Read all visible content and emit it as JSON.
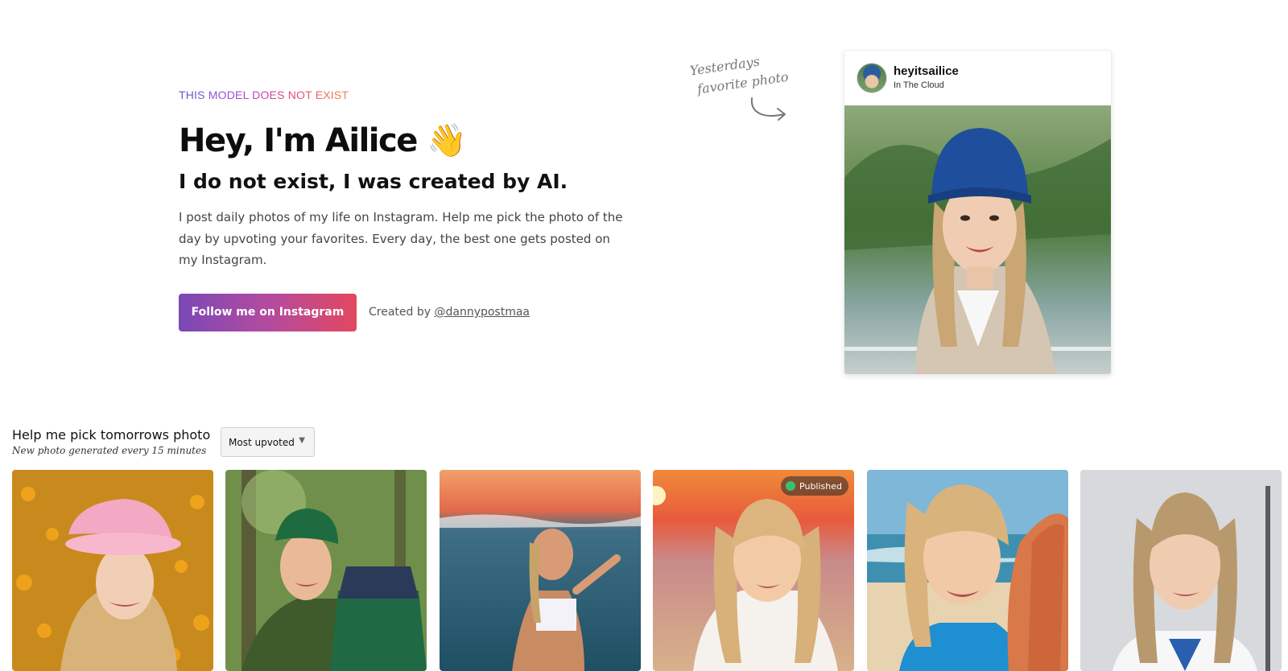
{
  "hero": {
    "eyebrow": "THIS MODEL DOES NOT EXIST",
    "title": "Hey, I'm Ailice 👋",
    "subtitle": "I do not exist, I was created by AI.",
    "description": "I post daily photos of my life on Instagram. Help me pick the photo of the day by upvoting your favorites. Every day, the best one gets posted on my Instagram.",
    "cta_label": "Follow me on Instagram",
    "credit_prefix": "Created by",
    "credit_handle": "@dannypostmaa"
  },
  "featured": {
    "note_line1": "Yesterdays",
    "note_line2": "favorite photo",
    "username": "heyitsailice",
    "location": "In The Cloud"
  },
  "picker": {
    "title": "Help me pick tomorrows photo",
    "subtitle": "New photo generated every 15 minutes",
    "sort_selected": "Most upvoted"
  },
  "photos": [
    {
      "scene": "flower-field-pink-hat",
      "published": false
    },
    {
      "scene": "forest-green-cap-backpack",
      "published": false
    },
    {
      "scene": "ocean-sunset-swimsuit",
      "published": false
    },
    {
      "scene": "beach-sunset-portrait",
      "published": true,
      "badge_label": "Published"
    },
    {
      "scene": "beach-surfboard",
      "published": false
    },
    {
      "scene": "clinic-portrait",
      "published": false
    }
  ],
  "colors": {
    "cta_start": "#7b48b6",
    "cta_end": "#e2485f",
    "published_dot": "#3bbf6e"
  }
}
